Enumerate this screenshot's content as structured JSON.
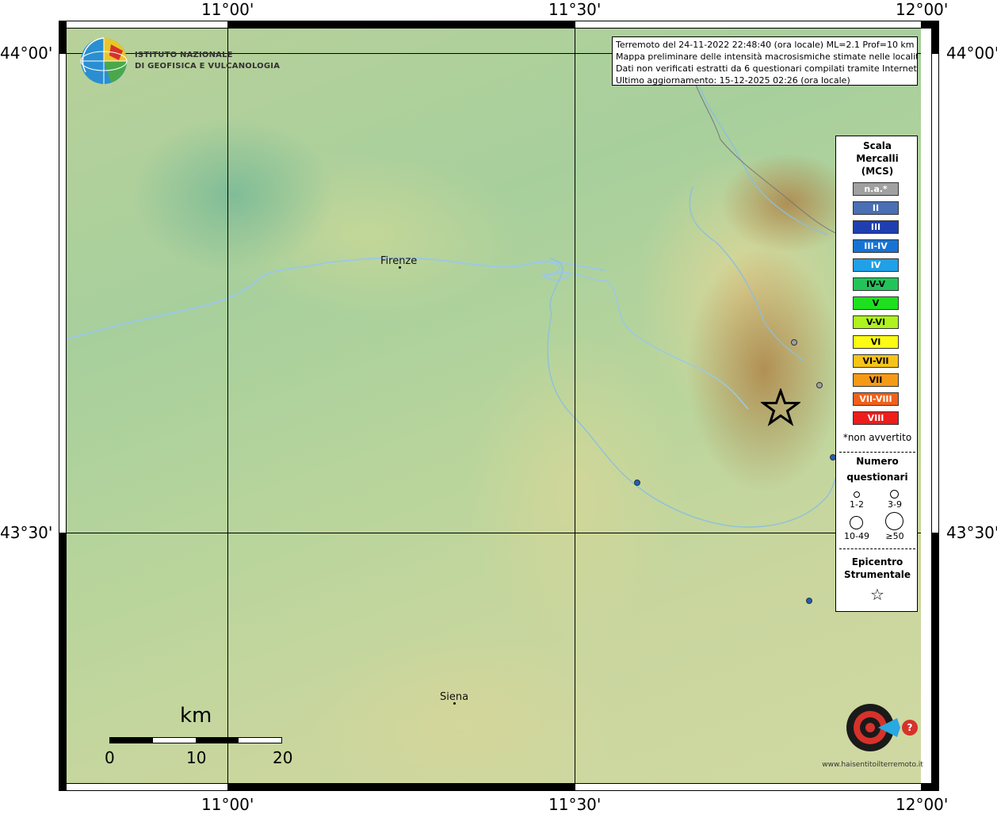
{
  "map": {
    "top_coords": [
      "11°00'",
      "11°30'",
      "12°00'"
    ],
    "bottom_coords": [
      "11°00'",
      "11°30'",
      "12°00'"
    ],
    "left_coords": [
      "44°00'",
      "43°30'"
    ],
    "right_coords": [
      "44°00'",
      "43°30'"
    ],
    "places": [
      {
        "name": "Firenze"
      },
      {
        "name": "Siena"
      }
    ]
  },
  "logos": {
    "ingv_line1": "ISTITUTO NAZIONALE",
    "ingv_line2": "DI GEOFISICA E VULCANOLOGIA",
    "hsit": "www.haisentitoilterremoto.it"
  },
  "info": {
    "line1": "Terremoto del 24-11-2022 22:48:40 (ora locale) ML=2.1 Prof=10 km",
    "line2": "Mappa preliminare delle intensità macrosismiche stimate nelle località",
    "line3": "Dati non verificati estratti da 6 questionari compilati tramite Internet.",
    "line4": "Ultimo aggiornamento: 15-12-2025 02:26 (ora locale)"
  },
  "legend": {
    "title1": "Scala",
    "title2": "Mercalli",
    "title3": "(MCS)",
    "classes": [
      {
        "label": "n.a.*",
        "color": "#a0a0a0"
      },
      {
        "label": "II",
        "color": "#4a6fb5"
      },
      {
        "label": "III",
        "color": "#1f3fb0"
      },
      {
        "label": "III-IV",
        "color": "#1673d6"
      },
      {
        "label": "IV",
        "color": "#20a0e6"
      },
      {
        "label": "IV-V",
        "color": "#22c45a"
      },
      {
        "label": "V",
        "color": "#1fe01f"
      },
      {
        "label": "V-VI",
        "color": "#aef21e"
      },
      {
        "label": "VI",
        "color": "#fbfb14"
      },
      {
        "label": "VI-VII",
        "color": "#f6c31a"
      },
      {
        "label": "VII",
        "color": "#f59a16"
      },
      {
        "label": "VII-VIII",
        "color": "#f0601a"
      },
      {
        "label": "VIII",
        "color": "#ef1c1c"
      }
    ],
    "non_felt_note": "*non avvertito",
    "count_title1": "Numero",
    "count_title2": "questionari",
    "sizes": [
      "1-2",
      "3-9",
      "10-49",
      "≥50"
    ],
    "epicenter_title1": "Epicentro",
    "epicenter_title2": "Strumentale",
    "epicenter_symbol": "☆"
  },
  "scale_bar": {
    "unit": "km",
    "ticks": [
      "0",
      "10",
      "20"
    ]
  },
  "observations": [
    {
      "mcs": "n.a.*",
      "color": "#a0a0a0"
    },
    {
      "mcs": "n.a.*",
      "color": "#a0a0a0"
    },
    {
      "mcs": "III-IV",
      "color": "#1f5fb8"
    },
    {
      "mcs": "III-IV",
      "color": "#1f5fb8"
    },
    {
      "mcs": "III-IV",
      "color": "#1f5fb8"
    }
  ],
  "epicenter": {
    "symbol": "☆"
  }
}
